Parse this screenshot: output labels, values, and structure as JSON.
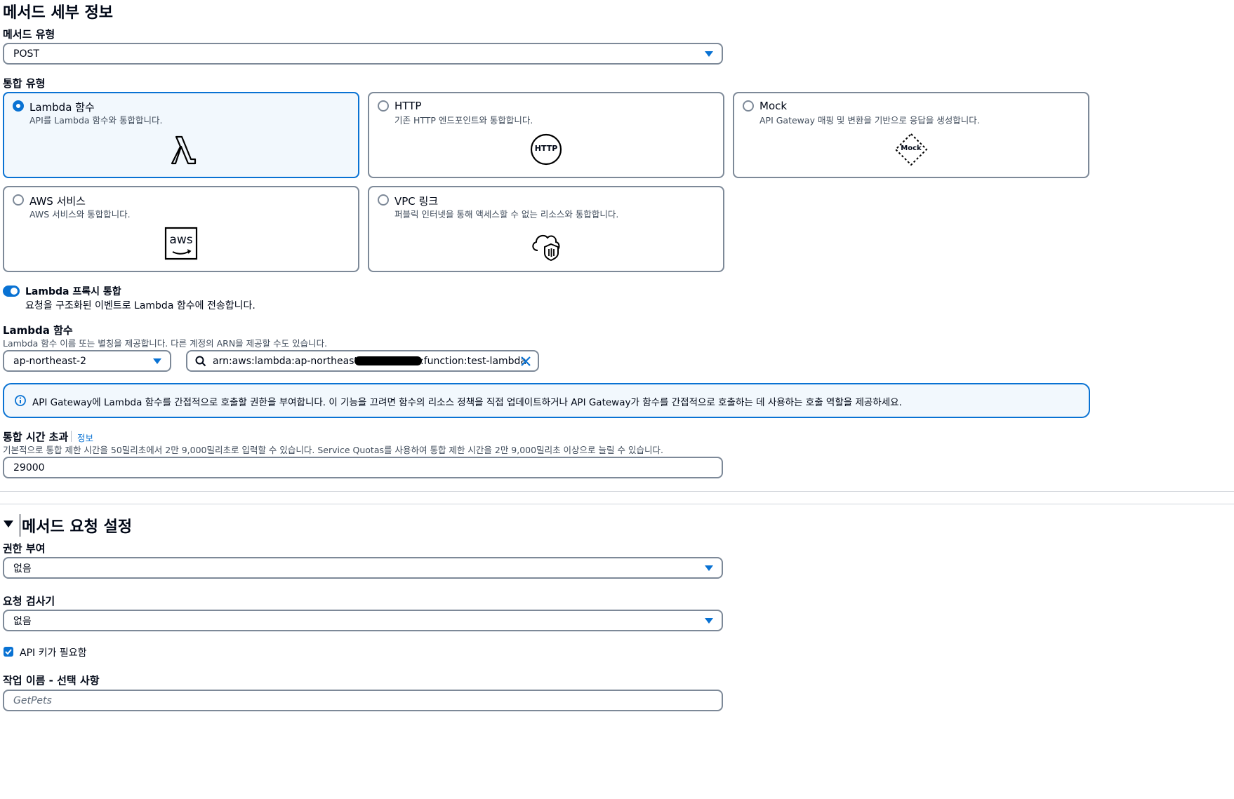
{
  "method_details": {
    "title": "메서드 세부 정보",
    "method_type_label": "메서드 유형",
    "method_type_value": "POST",
    "integration_type_label": "통합 유형",
    "options": [
      {
        "title": "Lambda 함수",
        "desc": "API를 Lambda 함수와 통합합니다.",
        "icon": "lambda-icon",
        "selected": true
      },
      {
        "title": "HTTP",
        "desc": "기존 HTTP 엔드포인트와 통합합니다.",
        "icon": "http-icon",
        "icon_text": "HTTP",
        "selected": false
      },
      {
        "title": "Mock",
        "desc": "API Gateway 매핑 및 변환을 기반으로 응답을 생성합니다.",
        "icon": "mock-icon",
        "icon_text": "Mock",
        "selected": false
      },
      {
        "title": "AWS 서비스",
        "desc": "AWS 서비스와 통합합니다.",
        "icon": "aws-icon",
        "icon_text": "aws",
        "selected": false
      },
      {
        "title": "VPC 링크",
        "desc": "퍼블릭 인터넷을 통해 액세스할 수 없는 리소스와 통합합니다.",
        "icon": "vpc-cloud-shield-icon",
        "selected": false
      }
    ],
    "proxy_toggle": {
      "label": "Lambda 프록시 통합",
      "desc": "요청을 구조화된 이벤트로 Lambda 함수에 전송합니다.",
      "on": true
    },
    "lambda_function": {
      "label": "Lambda 함수",
      "desc": "Lambda 함수 이름 또는 별칭을 제공합니다. 다른 계정의 ARN을 제공할 수도 있습니다.",
      "region": "ap-northeast-2",
      "arn_prefix": "arn:aws:lambda:ap-northeast-2:",
      "arn_suffix": ":function:test-lambda"
    },
    "info_alert": "API Gateway에 Lambda 함수를 간접적으로 호출할 권한을 부여합니다. 이 기능을 끄려면 함수의 리소스 정책을 직접 업데이트하거나 API Gateway가 함수를 간접적으로 호출하는 데 사용하는 호출 역할을 제공하세요.",
    "timeout": {
      "label": "통합 시간 초과",
      "info_link": "정보",
      "desc": "기본적으로 통합 제한 시간을 50밀리초에서 2만 9,000밀리초로 입력할 수 있습니다. Service Quotas를 사용하여 통합 제한 시간을 2만 9,000밀리초 이상으로 늘릴 수 있습니다.",
      "value": "29000"
    }
  },
  "method_request": {
    "title": "메서드 요청 설정",
    "auth_label": "권한 부여",
    "auth_value": "없음",
    "validator_label": "요청 검사기",
    "validator_value": "없음",
    "api_key_label": "API 키가 필요함",
    "api_key_checked": true,
    "operation_label": "작업 이름 - 선택 사항",
    "operation_placeholder": "GetPets"
  },
  "colors": {
    "accent": "#0972d3",
    "border": "#7d8998",
    "selected_bg": "#f2f8fd"
  }
}
